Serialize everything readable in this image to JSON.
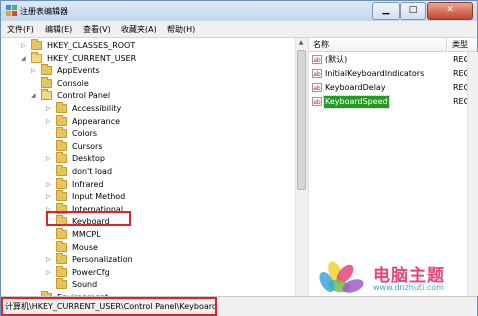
{
  "window": {
    "title": "注册表编辑器"
  },
  "menu": [
    "文件(F)",
    "编辑(E)",
    "查看(V)",
    "收藏夹(A)",
    "帮助(H)"
  ],
  "tree": [
    {
      "label": "HKEY_CLASSES_ROOT",
      "level": 1,
      "expander": "▷"
    },
    {
      "label": "HKEY_CURRENT_USER",
      "level": 1,
      "expander": "◢",
      "open": true
    },
    {
      "label": "AppEvents",
      "level": 2,
      "expander": "▷"
    },
    {
      "label": "Console",
      "level": 2,
      "expander": ""
    },
    {
      "label": "Control Panel",
      "level": 2,
      "expander": "◢",
      "open": true
    },
    {
      "label": "Accessibility",
      "level": 3,
      "expander": "▷"
    },
    {
      "label": "Appearance",
      "level": 3,
      "expander": "▷"
    },
    {
      "label": "Colors",
      "level": 3,
      "expander": ""
    },
    {
      "label": "Cursors",
      "level": 3,
      "expander": ""
    },
    {
      "label": "Desktop",
      "level": 3,
      "expander": "▷"
    },
    {
      "label": "don't load",
      "level": 3,
      "expander": ""
    },
    {
      "label": "Infrared",
      "level": 3,
      "expander": "▷"
    },
    {
      "label": "Input Method",
      "level": 3,
      "expander": "▷"
    },
    {
      "label": "International",
      "level": 3,
      "expander": "▷"
    },
    {
      "label": "Keyboard",
      "level": 3,
      "expander": "",
      "selected": true
    },
    {
      "label": "MMCPL",
      "level": 3,
      "expander": ""
    },
    {
      "label": "Mouse",
      "level": 3,
      "expander": ""
    },
    {
      "label": "Personalization",
      "level": 3,
      "expander": "▷"
    },
    {
      "label": "PowerCfg",
      "level": 3,
      "expander": "▷"
    },
    {
      "label": "Sound",
      "level": 3,
      "expander": ""
    },
    {
      "label": "Environment",
      "level": 2,
      "expander": ""
    }
  ],
  "values_pane": {
    "headers": {
      "name": "名称",
      "type": "类型"
    },
    "rows": [
      {
        "name": "(默认)",
        "type": "REG_"
      },
      {
        "name": "InitialKeyboardIndicators",
        "type": "REG_"
      },
      {
        "name": "KeyboardDelay",
        "type": "REG_"
      },
      {
        "name": "KeyboardSpeed",
        "type": "REG_",
        "selected": true
      }
    ]
  },
  "status": {
    "path": "计算机\\HKEY_CURRENT_USER\\Control Panel\\Keyboard"
  },
  "watermark": {
    "title": "电脑主题",
    "url": "www.dnzhuti.com"
  },
  "colors": {
    "selection_green": "#209c20",
    "annotation_red": "#d9252b",
    "folder_yellow": "#e9c45c"
  }
}
